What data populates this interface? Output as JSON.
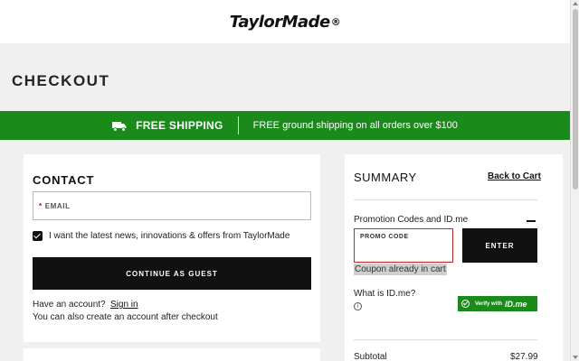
{
  "header": {
    "logo_text": "TaylorMade",
    "logo_mark": "®"
  },
  "page": {
    "title": "CHECKOUT"
  },
  "shipping_banner": {
    "icon": "truck-icon",
    "title": "FREE SHIPPING",
    "message": "FREE ground shipping on all orders over $100",
    "color": "#1a8a1a"
  },
  "contact": {
    "heading": "CONTACT",
    "email_required_mark": "*",
    "email_placeholder": "EMAIL",
    "newsletter_checked": true,
    "newsletter_label": "I want the latest news, innovations & offers from TaylorMade",
    "continue_label": "CONTINUE AS GUEST",
    "have_account": "Have an account?",
    "signin_label": "Sign in",
    "create_note": "You can also create an account after checkout"
  },
  "summary": {
    "heading": "SUMMARY",
    "back_label": "Back to Cart",
    "promo_section_label": "Promotion Codes and ID.me",
    "promo_placeholder": "PROMO CODE",
    "enter_label": "ENTER",
    "coupon_message": "Coupon already in cart",
    "idme_question": "What is ID.me?",
    "verify_label": "Verify with",
    "verify_brand": "ID.me",
    "subtotal_label": "Subtotal",
    "subtotal_value": "$27.99",
    "error_color": "#c0272d"
  }
}
